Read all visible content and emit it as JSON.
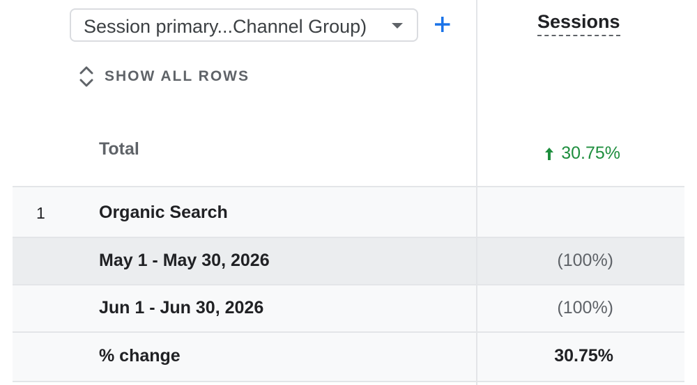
{
  "dimension_selector": {
    "label": "Session primary...Channel Group)",
    "icon": "caret-down-icon"
  },
  "add_dimension": {
    "icon": "plus-icon",
    "color": "#1a73e8"
  },
  "show_all_rows": {
    "label": "SHOW ALL ROWS",
    "icon": "unfold-more-icon"
  },
  "metric": {
    "header": "Sessions"
  },
  "total": {
    "label": "Total",
    "change": "30.75%",
    "change_icon": "arrow-up-icon",
    "change_color": "#1e8e3e"
  },
  "rows": [
    {
      "index": "1",
      "label": "Organic Search",
      "value": ""
    },
    {
      "index": "",
      "label": "May 1 - May 30, 2026",
      "value": "(100%)"
    },
    {
      "index": "",
      "label": "Jun 1 - Jun 30, 2026",
      "value": "(100%)"
    },
    {
      "index": "",
      "label": "% change",
      "value": "30.75%"
    }
  ]
}
